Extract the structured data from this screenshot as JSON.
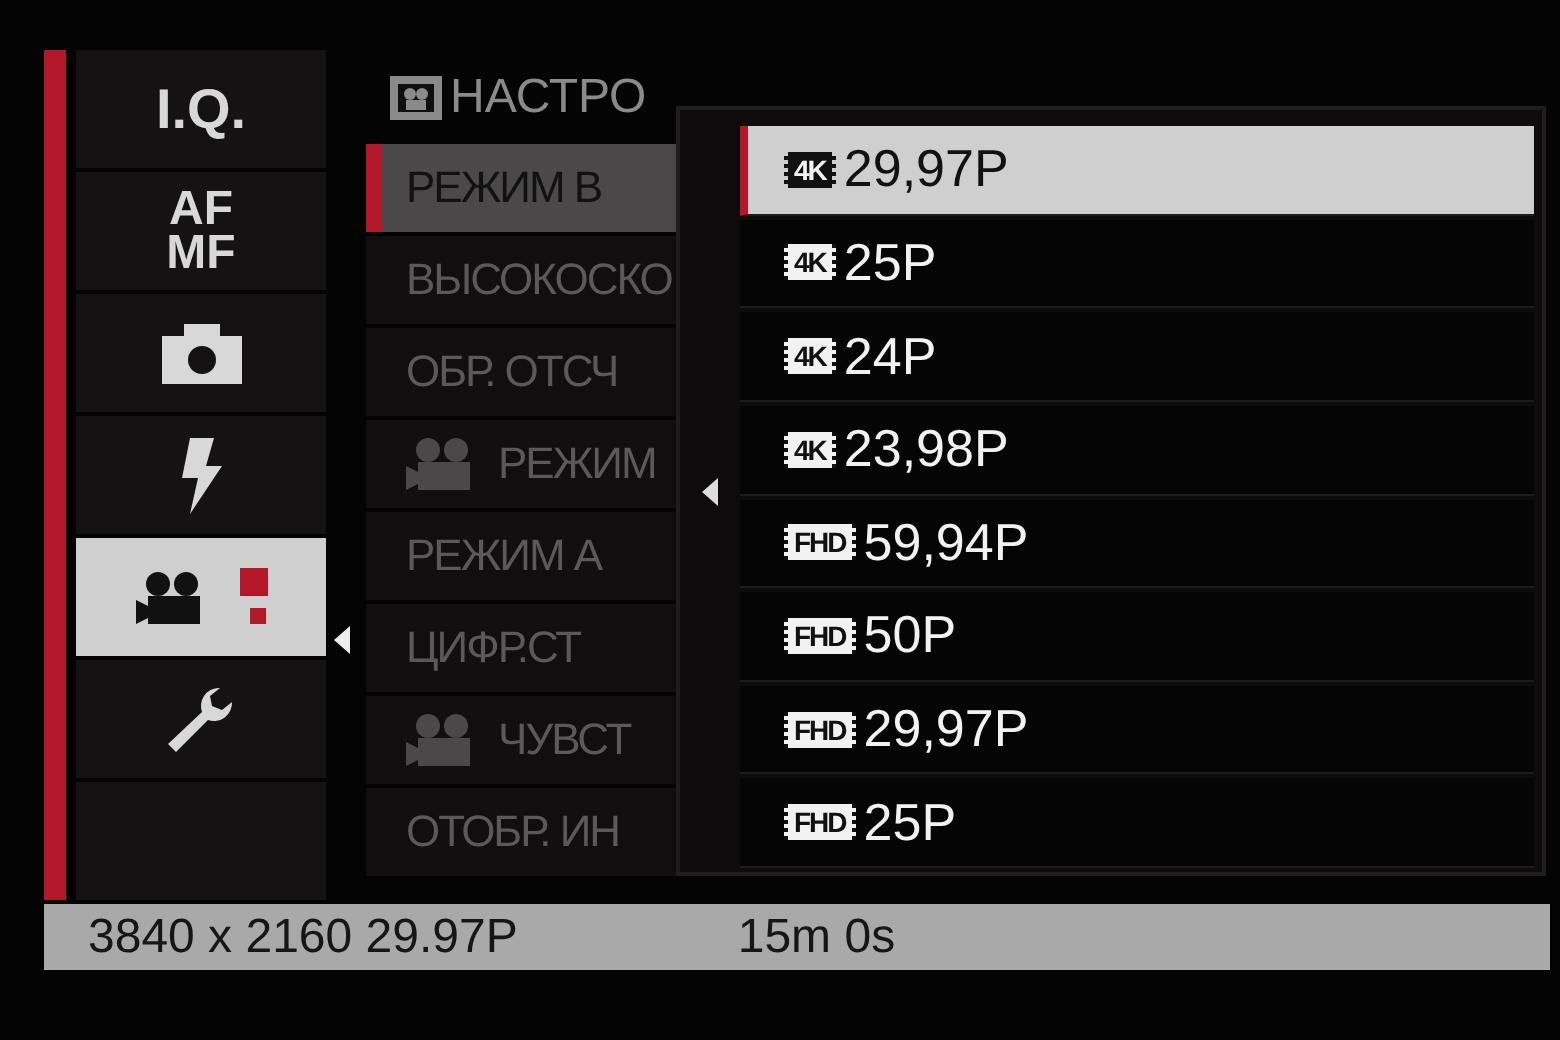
{
  "categories": [
    {
      "kind": "text",
      "lines": [
        "I.Q."
      ],
      "selected": false
    },
    {
      "kind": "text",
      "lines": [
        "AF",
        "MF"
      ],
      "selected": false
    },
    {
      "kind": "camera",
      "selected": false
    },
    {
      "kind": "flash",
      "selected": false
    },
    {
      "kind": "movie",
      "selected": true
    },
    {
      "kind": "wrench",
      "selected": false
    },
    {
      "kind": "empty",
      "selected": false
    }
  ],
  "menu": {
    "title": "НАСТРО",
    "items": [
      {
        "label": "РЕЖИМ В",
        "movie_icon": false,
        "selected": true
      },
      {
        "label": "ВЫСОКОСКО",
        "movie_icon": false,
        "selected": false
      },
      {
        "label": "ОБР. ОТСЧ",
        "movie_icon": false,
        "selected": false
      },
      {
        "label": "РЕЖИМ",
        "movie_icon": true,
        "selected": false
      },
      {
        "label": "РЕЖИМ А",
        "movie_icon": false,
        "selected": false
      },
      {
        "label": "ЦИФР.СТ",
        "movie_icon": false,
        "selected": false
      },
      {
        "label": "ЧУВСТ",
        "movie_icon": true,
        "selected": false
      },
      {
        "label": "ОТОБР. ИН",
        "movie_icon": false,
        "selected": false
      }
    ]
  },
  "options": [
    {
      "badge": "4K",
      "label": "29,97P",
      "selected": true
    },
    {
      "badge": "4K",
      "label": "25P",
      "selected": false
    },
    {
      "badge": "4K",
      "label": "24P",
      "selected": false
    },
    {
      "badge": "4K",
      "label": "23,98P",
      "selected": false
    },
    {
      "badge": "FHD",
      "label": "59,94P",
      "selected": false
    },
    {
      "badge": "FHD",
      "label": "50P",
      "selected": false
    },
    {
      "badge": "FHD",
      "label": "29,97P",
      "selected": false
    },
    {
      "badge": "FHD",
      "label": "25P",
      "selected": false
    }
  ],
  "status_bar": {
    "resolution": "3840 x 2160 29.97P",
    "time": "15m 0s"
  }
}
